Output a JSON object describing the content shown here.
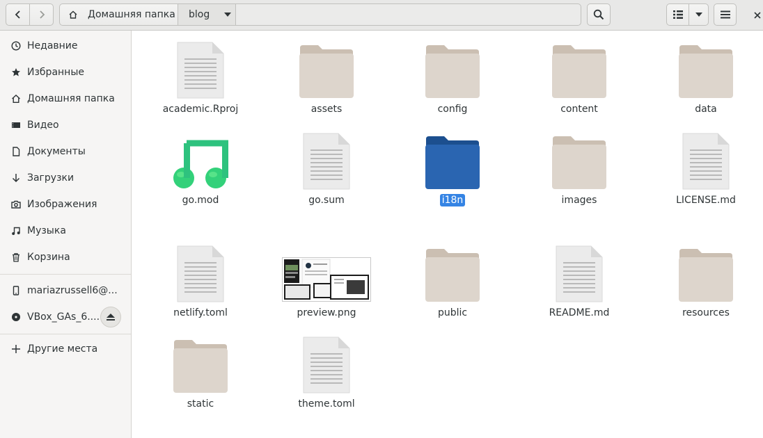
{
  "header": {
    "path_home": "Домашняя папка",
    "path_current": "blog"
  },
  "sidebar": {
    "items": [
      {
        "label": "Недавние",
        "icon": "clock-icon"
      },
      {
        "label": "Избранные",
        "icon": "star-icon"
      },
      {
        "label": "Домашняя папка",
        "icon": "home-icon"
      },
      {
        "label": "Видео",
        "icon": "video-icon"
      },
      {
        "label": "Документы",
        "icon": "document-icon"
      },
      {
        "label": "Загрузки",
        "icon": "download-icon"
      },
      {
        "label": "Изображения",
        "icon": "camera-icon"
      },
      {
        "label": "Музыка",
        "icon": "music-icon"
      },
      {
        "label": "Корзина",
        "icon": "trash-icon"
      }
    ],
    "devices": [
      {
        "label": "mariazrussell6@...",
        "icon": "phone-icon"
      },
      {
        "label": "VBox_GAs_6....",
        "icon": "disc-icon"
      }
    ],
    "other": {
      "label": "Другие места",
      "icon": "plus-icon"
    }
  },
  "files": [
    {
      "name": "academic.Rproj",
      "type": "text"
    },
    {
      "name": "assets",
      "type": "folder"
    },
    {
      "name": "config",
      "type": "folder"
    },
    {
      "name": "content",
      "type": "folder"
    },
    {
      "name": "data",
      "type": "folder"
    },
    {
      "name": "go.mod",
      "type": "music"
    },
    {
      "name": "go.sum",
      "type": "text"
    },
    {
      "name": "i18n",
      "type": "folder",
      "selected": true
    },
    {
      "name": "images",
      "type": "folder"
    },
    {
      "name": "LICENSE.md",
      "type": "text"
    },
    {
      "name": "netlify.toml",
      "type": "text"
    },
    {
      "name": "preview.png",
      "type": "image"
    },
    {
      "name": "public",
      "type": "folder"
    },
    {
      "name": "README.md",
      "type": "text"
    },
    {
      "name": "resources",
      "type": "folder"
    },
    {
      "name": "static",
      "type": "folder"
    },
    {
      "name": "theme.toml",
      "type": "text"
    }
  ],
  "colors": {
    "folder": "#ddd5cc",
    "folder_tab": "#cbbfb2",
    "folder_selected": "#2a65b1",
    "selection": "#3584e4",
    "music_green": "#33d17a"
  }
}
